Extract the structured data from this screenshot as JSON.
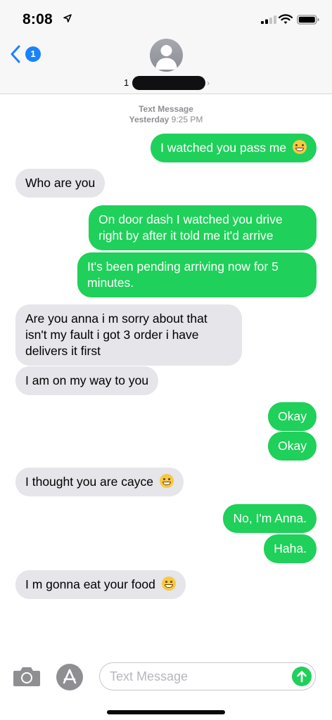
{
  "status_bar": {
    "time": "8:08",
    "icons": [
      "location-arrow-icon",
      "cellular-signal-icon",
      "wifi-icon",
      "battery-icon"
    ]
  },
  "header": {
    "back_badge_count": "1",
    "contact_name_prefix": "1",
    "contact_name_redacted": true,
    "icons": [
      "chevron-left-icon",
      "avatar-icon",
      "chevron-right-icon"
    ]
  },
  "conversation": {
    "service_label": "Text Message",
    "timestamp_day": "Yesterday",
    "timestamp_time": "9:25 PM",
    "messages": [
      {
        "direction": "sent",
        "text": "I watched you pass me",
        "emoji": "laughing-tears"
      },
      {
        "direction": "received",
        "text": "Who are you"
      },
      {
        "direction": "sent",
        "text": "On door dash I watched you drive right by after it told me it'd arrive"
      },
      {
        "direction": "sent",
        "text": "It's been pending arriving now for 5 minutes."
      },
      {
        "direction": "received",
        "text": "Are you anna i m sorry about that isn't my fault i got 3 order i have delivers it first"
      },
      {
        "direction": "received",
        "text": "I am on my way to you"
      },
      {
        "direction": "sent",
        "text": "Okay"
      },
      {
        "direction": "sent",
        "text": "Okay"
      },
      {
        "direction": "received",
        "text": "I thought you are cayce",
        "emoji": "grinning"
      },
      {
        "direction": "sent",
        "text": "No, I'm Anna."
      },
      {
        "direction": "sent",
        "text": "Haha."
      },
      {
        "direction": "received",
        "text": "I m gonna eat your food",
        "emoji": "grinning"
      }
    ]
  },
  "input_bar": {
    "placeholder": "Text Message",
    "value": "",
    "icons": [
      "camera-icon",
      "app-store-icon",
      "send-arrow-icon"
    ]
  },
  "colors": {
    "sent_bubble": "#1fd05a",
    "received_bubble": "#e5e5ea",
    "accent_blue": "#1a82fb"
  }
}
